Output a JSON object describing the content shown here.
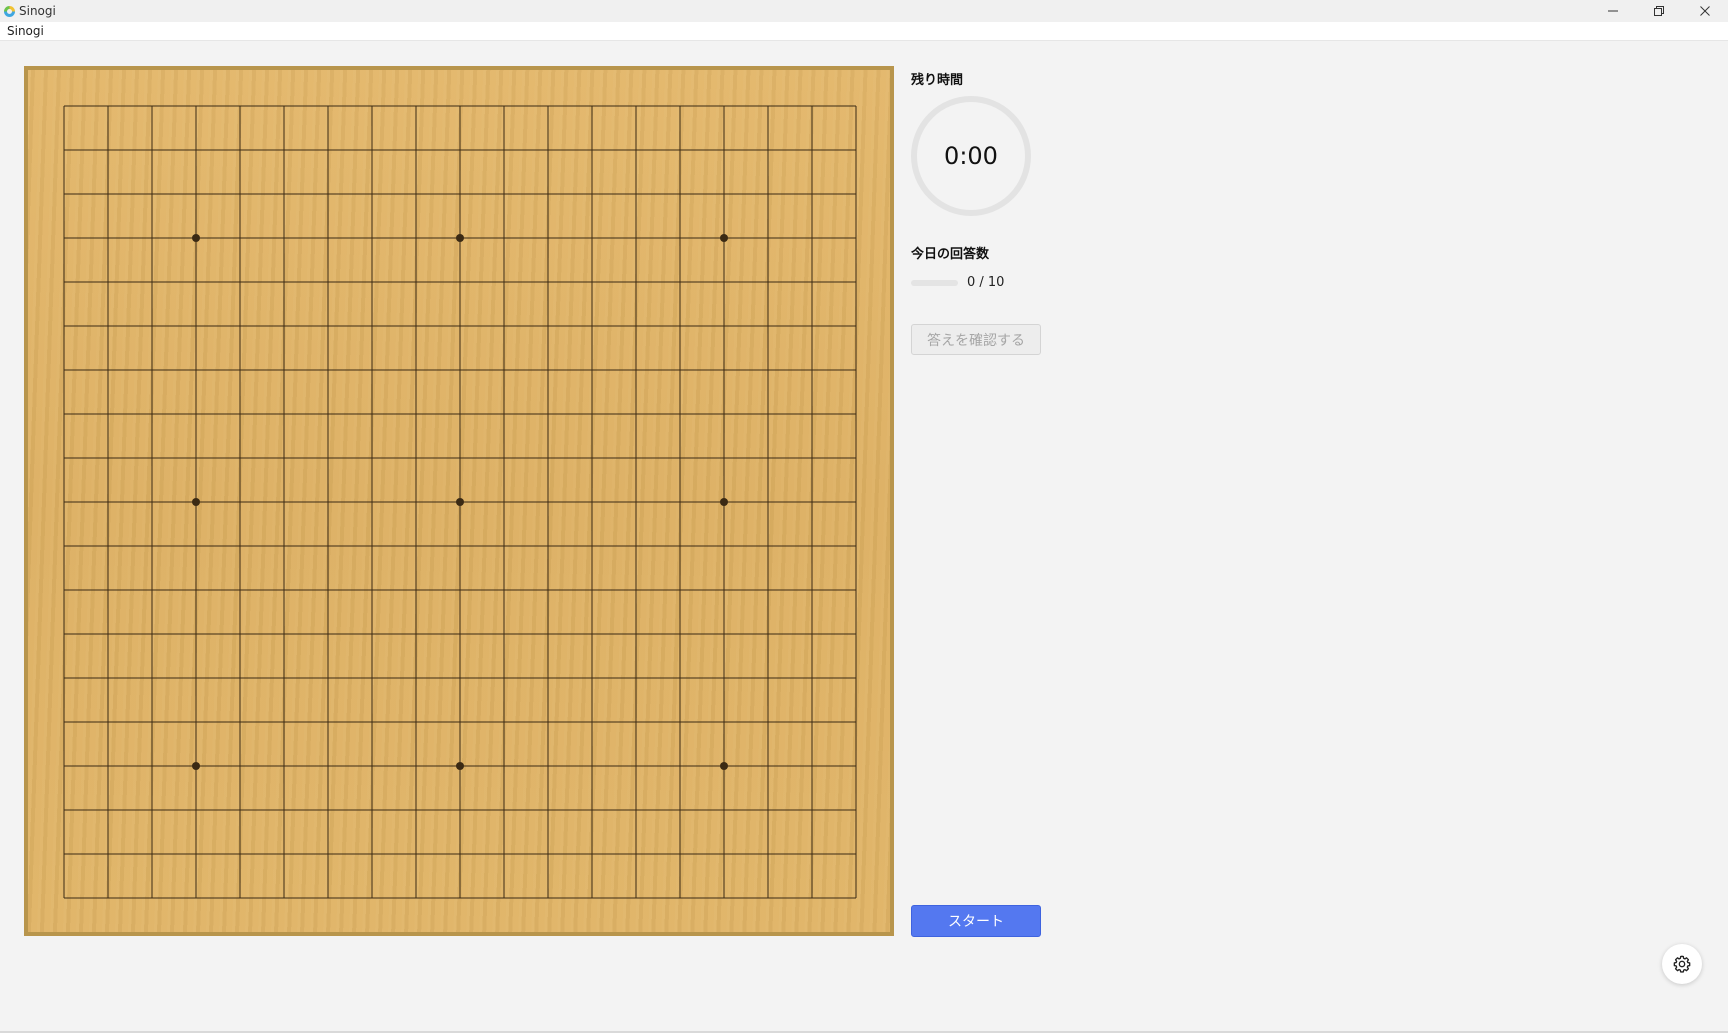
{
  "window": {
    "title": "Sinogi",
    "controls": [
      "minimize-icon",
      "restore-icon",
      "close-icon"
    ]
  },
  "menu": {
    "items": [
      "Sinogi"
    ]
  },
  "board": {
    "size": 19,
    "star_points": [
      [
        3,
        3
      ],
      [
        3,
        9
      ],
      [
        3,
        15
      ],
      [
        9,
        3
      ],
      [
        9,
        9
      ],
      [
        9,
        15
      ],
      [
        15,
        3
      ],
      [
        15,
        9
      ],
      [
        15,
        15
      ]
    ],
    "colors": {
      "wood": "#ddb062",
      "frame": "#b8954c",
      "line": "#3b2a14"
    }
  },
  "panel": {
    "timer_label": "残り時間",
    "timer_value": "0:00",
    "count_label": "今日の回答数",
    "count_text": "0 / 10",
    "progress": 0,
    "check_button": "答えを確認する",
    "start_button": "スタート"
  },
  "colors": {
    "accent": "#5478f0",
    "background": "#f3f3f3"
  },
  "icons": {
    "settings": "gear-icon"
  }
}
